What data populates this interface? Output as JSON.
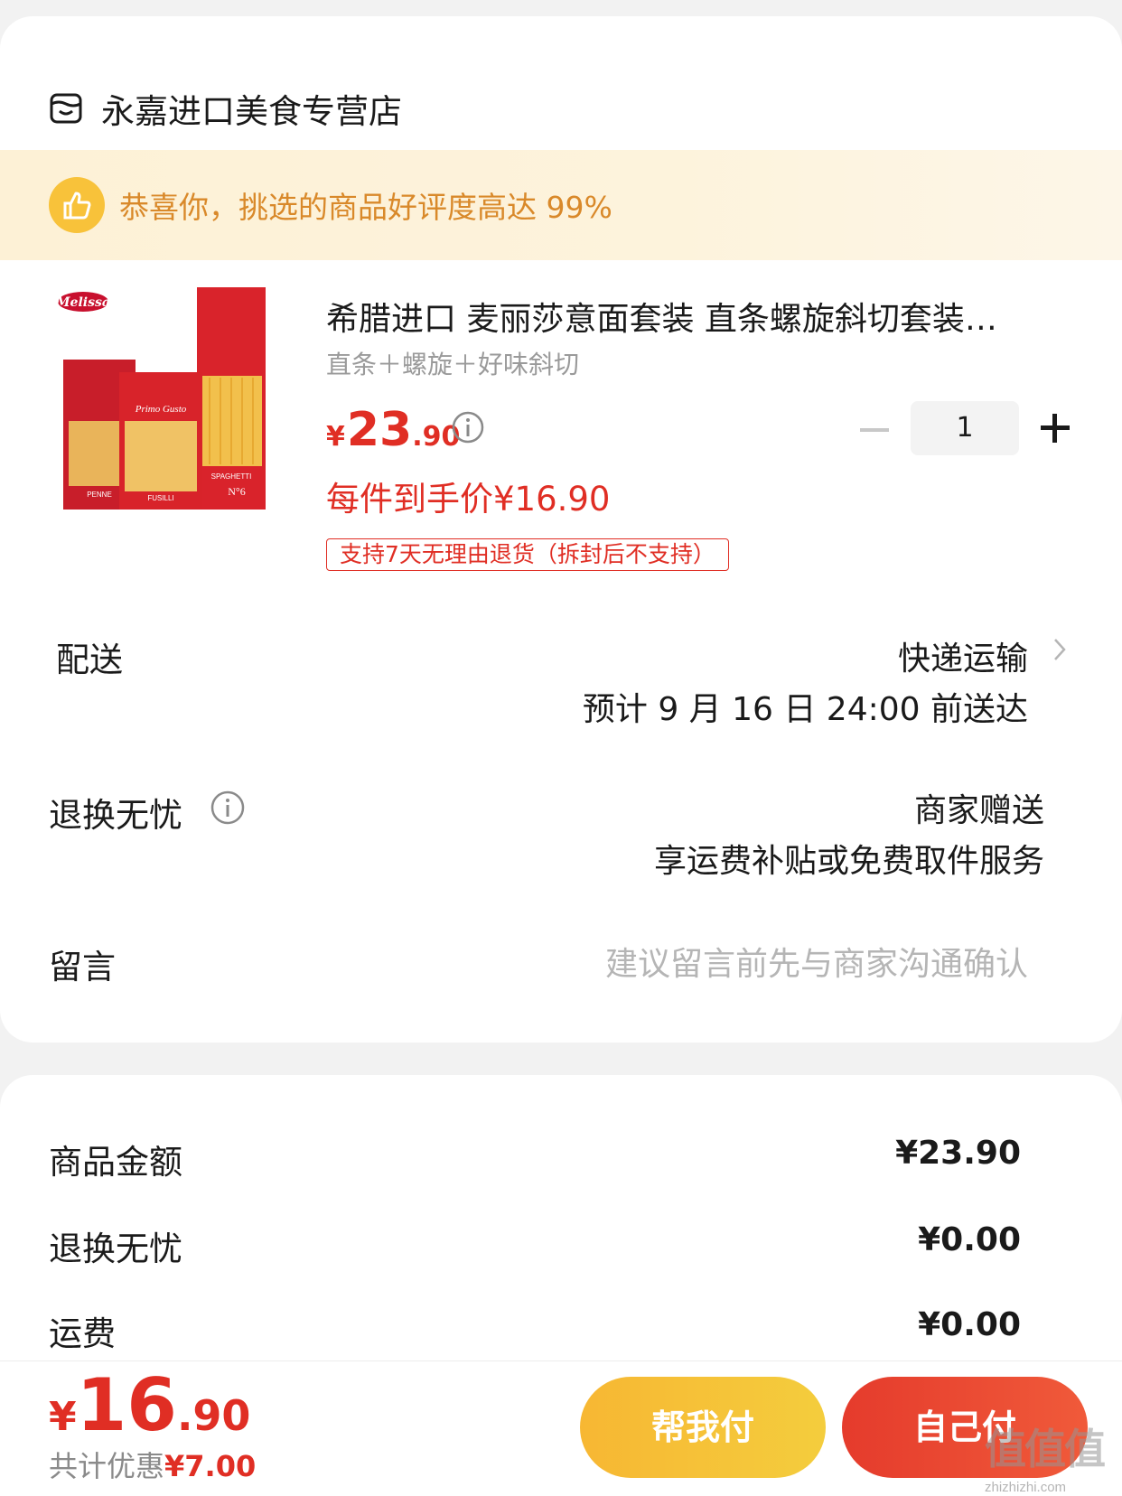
{
  "store": {
    "name": "永嘉进口美食专营店",
    "icon": "store-icon"
  },
  "banner": {
    "text": "恭喜你，挑选的商品好评度高达 99%",
    "icon": "thumbs-up-icon"
  },
  "product": {
    "title": "希腊进口 麦丽莎意面套装 直条螺旋斜切套装…",
    "variant": "直条＋螺旋＋好味斜切",
    "price_symbol": "¥",
    "price_int": "23",
    "price_dec": ".90",
    "unit_price": "每件到手价¥16.90",
    "refund_tag": "支持7天无理由退货（拆封后不支持）",
    "quantity": "1",
    "image_brand": "Melissa",
    "image_labels": [
      "Primo Gusto",
      "PENNE",
      "FUSILLI",
      "SPAGHETTI",
      "N°6"
    ]
  },
  "delivery": {
    "label": "配送",
    "method": "快递运输",
    "eta": "预计 9 月 16 日 24:00 前送达"
  },
  "returns": {
    "label": "退换无忧",
    "value": "商家赠送",
    "desc": "享运费补贴或免费取件服务"
  },
  "message": {
    "label": "留言",
    "placeholder": "建议留言前先与商家沟通确认"
  },
  "summary": [
    {
      "label": "商品金额",
      "value": "¥23.90"
    },
    {
      "label": "退换无忧",
      "value": "¥0.00"
    },
    {
      "label": "运费",
      "value": "¥0.00"
    }
  ],
  "footer": {
    "total_symbol": "¥",
    "total_int": "16",
    "total_dec": ".90",
    "discount_label": "共计优惠",
    "discount_value": "¥7.00",
    "help_pay": "帮我付",
    "self_pay": "自己付"
  },
  "watermark": {
    "main": "值值值",
    "sub": "zhizhizhi.com"
  },
  "colors": {
    "accent": "#e02e24",
    "banner_text": "#d9892a",
    "help_pay": "#f5c03a"
  }
}
